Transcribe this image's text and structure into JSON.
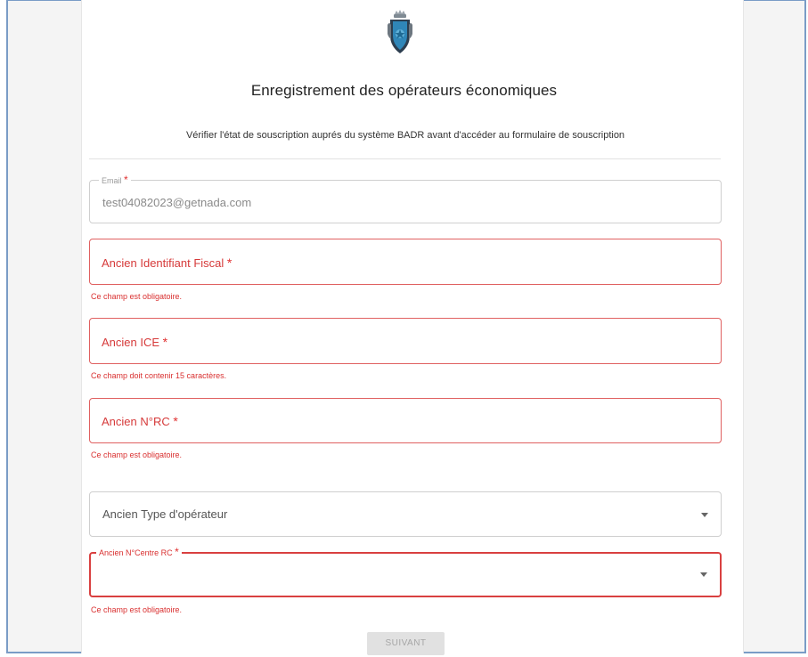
{
  "form": {
    "title": "Enregistrement des opérateurs économiques",
    "subtitle": "Vérifier l'état de souscription auprés du système BADR avant d'accéder au formulaire de souscription",
    "required_mark": "*",
    "email": {
      "label": "Email",
      "value": "test04082023@getnada.com"
    },
    "identifiant_fiscal": {
      "label": "Ancien Identifiant Fiscal",
      "error": "Ce champ est obligatoire."
    },
    "ice": {
      "label": "Ancien ICE",
      "error": "Ce champ doit contenir 15 caractères."
    },
    "rc": {
      "label": "Ancien N°RC",
      "error": "Ce champ est obligatoire."
    },
    "type_operateur": {
      "label": "Ancien Type d'opérateur"
    },
    "centre_rc": {
      "label": "Ancien N°Centre RC",
      "error": "Ce champ est obligatoire."
    },
    "submit_label": "SUIVANT"
  },
  "colors": {
    "error_red": "#d93030",
    "emblem_blue": "#2f86b8",
    "frame_blue": "#7a9cc6"
  },
  "icons": {
    "emblem": "coat-of-arms-icon",
    "dropdown": "caret-down-icon"
  }
}
